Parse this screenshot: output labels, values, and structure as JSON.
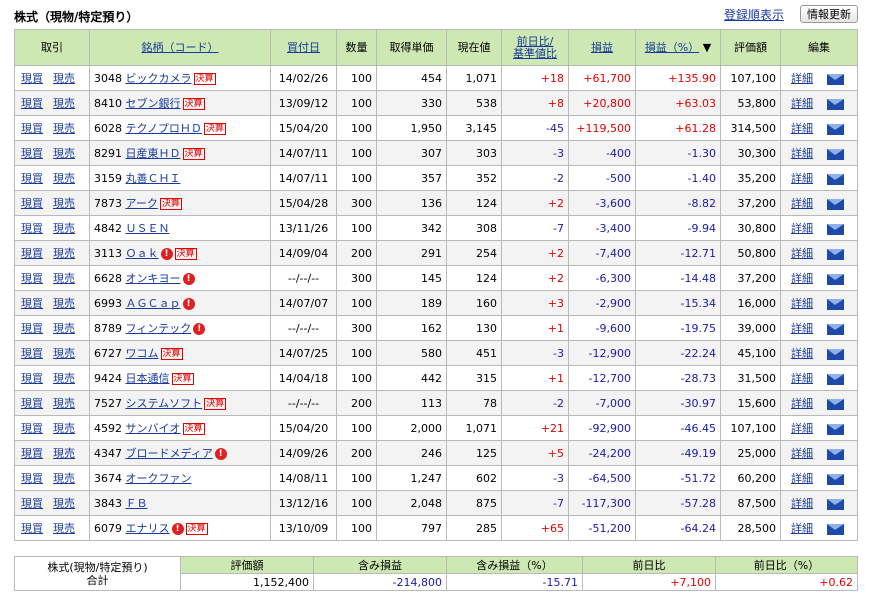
{
  "page": {
    "title": "株式（現物/特定預り）",
    "sort_link": "登録順表示",
    "refresh_button": "情報更新"
  },
  "table": {
    "headers": {
      "trade": "取引",
      "name": "銘柄（コード）",
      "date": "買付日",
      "qty": "数量",
      "cost": "取得単価",
      "price": "現在値",
      "change_1": "前日比/",
      "change_2": "基準値比",
      "pl": "損益",
      "plpct": "損益（%）",
      "sort_arrow": "▼",
      "value": "評価額",
      "edit": "編集"
    },
    "labels": {
      "buy": "現買",
      "sell": "現売",
      "detail": "詳細",
      "settlement": "決算",
      "alert": "!"
    },
    "rows": [
      {
        "code": "3048",
        "name": "ビックカメラ",
        "badge": true,
        "alert": false,
        "date": "14/02/26",
        "qty": "100",
        "cost": "454",
        "price": "1,071",
        "change": "+18",
        "pl": "+61,700",
        "plpct": "+135.90",
        "value": "107,100"
      },
      {
        "code": "8410",
        "name": "セブン銀行",
        "badge": true,
        "alert": false,
        "date": "13/09/12",
        "qty": "100",
        "cost": "330",
        "price": "538",
        "change": "+8",
        "pl": "+20,800",
        "plpct": "+63.03",
        "value": "53,800"
      },
      {
        "code": "6028",
        "name": "テクノプロＨＤ",
        "badge": true,
        "alert": false,
        "date": "15/04/20",
        "qty": "100",
        "cost": "1,950",
        "price": "3,145",
        "change": "-45",
        "pl": "+119,500",
        "plpct": "+61.28",
        "value": "314,500"
      },
      {
        "code": "8291",
        "name": "日産東ＨＤ",
        "badge": true,
        "alert": false,
        "date": "14/07/11",
        "qty": "100",
        "cost": "307",
        "price": "303",
        "change": "-3",
        "pl": "-400",
        "plpct": "-1.30",
        "value": "30,300"
      },
      {
        "code": "3159",
        "name": "丸善ＣＨＩ",
        "badge": false,
        "alert": false,
        "date": "14/07/11",
        "qty": "100",
        "cost": "357",
        "price": "352",
        "change": "-2",
        "pl": "-500",
        "plpct": "-1.40",
        "value": "35,200"
      },
      {
        "code": "7873",
        "name": "アーク",
        "badge": true,
        "alert": false,
        "date": "15/04/28",
        "qty": "300",
        "cost": "136",
        "price": "124",
        "change": "+2",
        "pl": "-3,600",
        "plpct": "-8.82",
        "value": "37,200"
      },
      {
        "code": "4842",
        "name": "ＵＳＥＮ",
        "badge": false,
        "alert": false,
        "date": "13/11/26",
        "qty": "100",
        "cost": "342",
        "price": "308",
        "change": "-7",
        "pl": "-3,400",
        "plpct": "-9.94",
        "value": "30,800"
      },
      {
        "code": "3113",
        "name": "Ｏａｋ",
        "badge": true,
        "alert": true,
        "date": "14/09/04",
        "qty": "200",
        "cost": "291",
        "price": "254",
        "change": "+2",
        "pl": "-7,400",
        "plpct": "-12.71",
        "value": "50,800"
      },
      {
        "code": "6628",
        "name": "オンキヨー",
        "badge": false,
        "alert": true,
        "date": "--/--/--",
        "qty": "300",
        "cost": "145",
        "price": "124",
        "change": "+2",
        "pl": "-6,300",
        "plpct": "-14.48",
        "value": "37,200"
      },
      {
        "code": "6993",
        "name": "ＡＧＣａｐ",
        "badge": false,
        "alert": true,
        "date": "14/07/07",
        "qty": "100",
        "cost": "189",
        "price": "160",
        "change": "+3",
        "pl": "-2,900",
        "plpct": "-15.34",
        "value": "16,000"
      },
      {
        "code": "8789",
        "name": "フィンテック",
        "badge": false,
        "alert": true,
        "date": "--/--/--",
        "qty": "300",
        "cost": "162",
        "price": "130",
        "change": "+1",
        "pl": "-9,600",
        "plpct": "-19.75",
        "value": "39,000"
      },
      {
        "code": "6727",
        "name": "ワコム",
        "badge": true,
        "alert": false,
        "date": "14/07/25",
        "qty": "100",
        "cost": "580",
        "price": "451",
        "change": "-3",
        "pl": "-12,900",
        "plpct": "-22.24",
        "value": "45,100"
      },
      {
        "code": "9424",
        "name": "日本通信",
        "badge": true,
        "alert": false,
        "date": "14/04/18",
        "qty": "100",
        "cost": "442",
        "price": "315",
        "change": "+1",
        "pl": "-12,700",
        "plpct": "-28.73",
        "value": "31,500"
      },
      {
        "code": "7527",
        "name": "システムソフト",
        "badge": true,
        "alert": false,
        "date": "--/--/--",
        "qty": "200",
        "cost": "113",
        "price": "78",
        "change": "-2",
        "pl": "-7,000",
        "plpct": "-30.97",
        "value": "15,600"
      },
      {
        "code": "4592",
        "name": "サンバイオ",
        "badge": true,
        "alert": false,
        "date": "15/04/20",
        "qty": "100",
        "cost": "2,000",
        "price": "1,071",
        "change": "+21",
        "pl": "-92,900",
        "plpct": "-46.45",
        "value": "107,100"
      },
      {
        "code": "4347",
        "name": "ブロードメディア",
        "badge": false,
        "alert": true,
        "date": "14/09/26",
        "qty": "200",
        "cost": "246",
        "price": "125",
        "change": "+5",
        "pl": "-24,200",
        "plpct": "-49.19",
        "value": "25,000"
      },
      {
        "code": "3674",
        "name": "オークファン",
        "badge": false,
        "alert": false,
        "date": "14/08/11",
        "qty": "100",
        "cost": "1,247",
        "price": "602",
        "change": "-3",
        "pl": "-64,500",
        "plpct": "-51.72",
        "value": "60,200"
      },
      {
        "code": "3843",
        "name": "ＦＢ",
        "badge": false,
        "alert": false,
        "date": "13/12/16",
        "qty": "100",
        "cost": "2,048",
        "price": "875",
        "change": "-7",
        "pl": "-117,300",
        "plpct": "-57.28",
        "value": "87,500"
      },
      {
        "code": "6079",
        "name": "エナリス",
        "badge": true,
        "alert": true,
        "date": "13/10/09",
        "qty": "100",
        "cost": "797",
        "price": "285",
        "change": "+65",
        "pl": "-51,200",
        "plpct": "-64.24",
        "value": "28,500"
      }
    ]
  },
  "summary": {
    "label_1": "株式(現物/特定預り)",
    "label_2": "合計",
    "headers": {
      "value": "評価額",
      "pl": "含み損益",
      "plpct": "含み損益（%）",
      "change": "前日比",
      "changepct": "前日比（%）"
    },
    "values": {
      "value": "1,152,400",
      "pl": "-214,800",
      "plpct": "-15.71",
      "change": "+7,100",
      "changepct": "+0.62"
    }
  },
  "colors": {
    "header_bg": "#cde8b2",
    "positive": "#e00000",
    "negative": "#1a1aa6",
    "link": "#1a3a9a"
  }
}
